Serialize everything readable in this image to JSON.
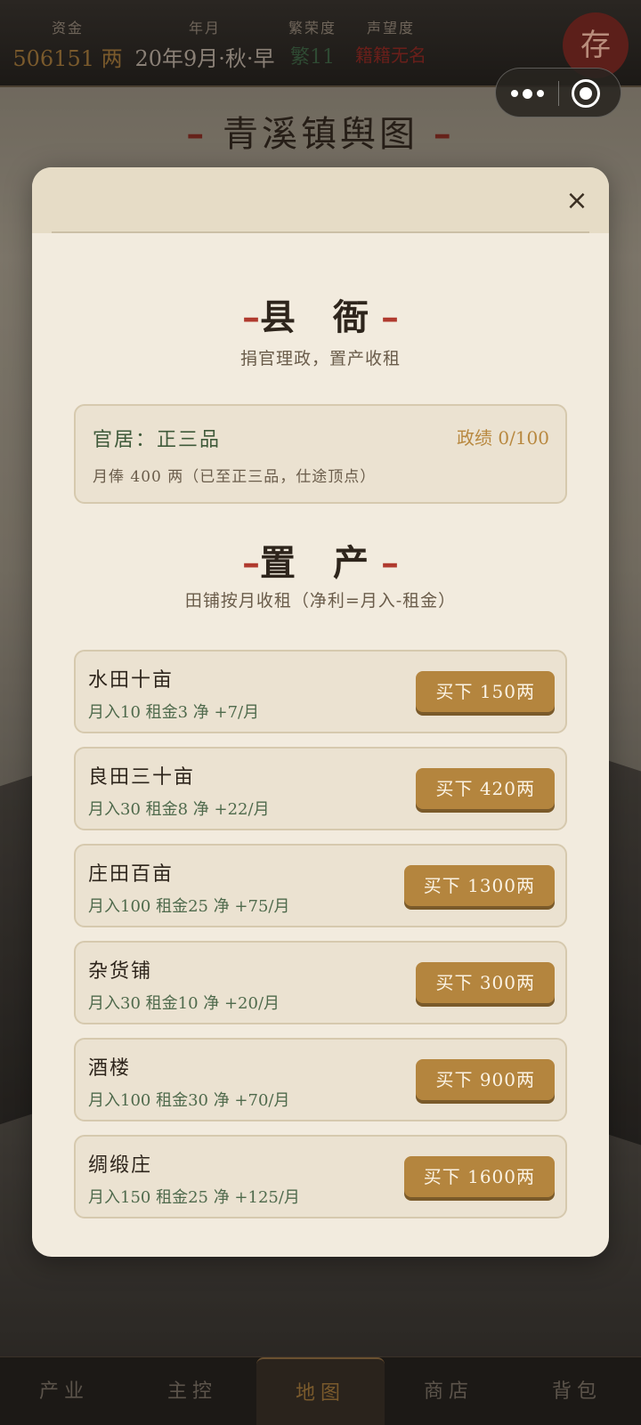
{
  "topbar": {
    "money_label": "资金",
    "money_value": "506151 两",
    "date_label": "年月",
    "date_value": "20年9月·秋·早",
    "prosper_label": "繁荣度",
    "prosper_value": "繁11",
    "fame_label": "声望度",
    "fame_value": "籍籍无名",
    "save_label": "存"
  },
  "map": {
    "title": "青溪镇舆图"
  },
  "modal": {
    "close_label": "×",
    "office": {
      "title": "县 衙",
      "subtitle": "捐官理政，置产收租",
      "rank": "官居：正三品",
      "merit": "政绩 0/100",
      "salary": "月俸 400 两（已至正三品，仕途顶点）"
    },
    "estate": {
      "title": "置 产",
      "subtitle": "田铺按月收租（净利=月入-租金）",
      "items": [
        {
          "name": "水田十亩",
          "info": "月入10 租金3 净 +7/月",
          "buy": "买下 150两"
        },
        {
          "name": "良田三十亩",
          "info": "月入30 租金8 净 +22/月",
          "buy": "买下 420两"
        },
        {
          "name": "庄田百亩",
          "info": "月入100 租金25 净 +75/月",
          "buy": "买下 1300两"
        },
        {
          "name": "杂货铺",
          "info": "月入30 租金10 净 +20/月",
          "buy": "买下 300两"
        },
        {
          "name": "酒楼",
          "info": "月入100 租金30 净 +70/月",
          "buy": "买下 900两"
        },
        {
          "name": "绸缎庄",
          "info": "月入150 租金25 净 +125/月",
          "buy": "买下 1600两"
        }
      ]
    }
  },
  "nav": {
    "items": [
      "产业",
      "主控",
      "地图",
      "商店",
      "背包"
    ],
    "active_index": 2
  }
}
